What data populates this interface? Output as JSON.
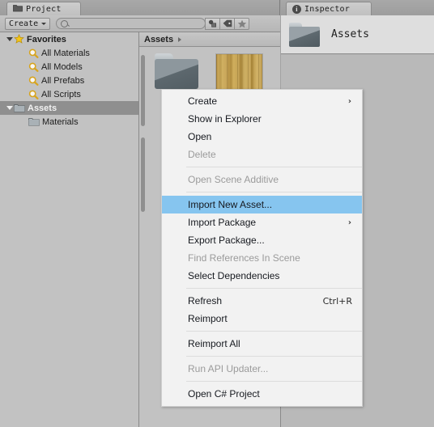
{
  "project_panel": {
    "tab_label": "Project",
    "tab_icon": "folder-icon",
    "toolbar": {
      "create_label": "Create",
      "search_value": "",
      "search_placeholder": "",
      "filter_buttons": [
        {
          "name": "filter-by-type-icon",
          "glyph": "◤"
        },
        {
          "name": "filter-by-label-icon",
          "glyph": "◆"
        },
        {
          "name": "filter-by-favorite-icon",
          "glyph": "★"
        }
      ]
    },
    "tree": [
      {
        "label": "Favorites",
        "icon": "star-icon",
        "indent": 0,
        "expanded": true,
        "bold": true,
        "selected": false
      },
      {
        "label": "All Materials",
        "icon": "search-icon",
        "indent": 1,
        "expanded": null,
        "bold": false,
        "selected": false
      },
      {
        "label": "All Models",
        "icon": "search-icon",
        "indent": 1,
        "expanded": null,
        "bold": false,
        "selected": false
      },
      {
        "label": "All Prefabs",
        "icon": "search-icon",
        "indent": 1,
        "expanded": null,
        "bold": false,
        "selected": false
      },
      {
        "label": "All Scripts",
        "icon": "search-icon",
        "indent": 1,
        "expanded": null,
        "bold": false,
        "selected": false
      },
      {
        "label": "Assets",
        "icon": "folder-icon",
        "indent": 0,
        "expanded": true,
        "bold": true,
        "selected": true
      },
      {
        "label": "Materials",
        "icon": "folder-icon",
        "indent": 1,
        "expanded": null,
        "bold": false,
        "selected": false
      }
    ],
    "breadcrumb": "Assets",
    "assets": [
      {
        "name": "folder-asset",
        "kind": "folder",
        "label": ""
      },
      {
        "name": "wood-texture-asset",
        "kind": "texture",
        "label": ""
      }
    ]
  },
  "inspector_panel": {
    "tab_label": "Inspector",
    "tab_icon": "info-icon",
    "badge_char": "i",
    "header_title": "Assets",
    "header_icon": "folder-icon"
  },
  "context_menu": {
    "items": [
      {
        "label": "Create",
        "type": "item",
        "disabled": false,
        "highlight": false,
        "submenu": true,
        "shortcut": ""
      },
      {
        "label": "Show in Explorer",
        "type": "item",
        "disabled": false,
        "highlight": false,
        "submenu": false,
        "shortcut": ""
      },
      {
        "label": "Open",
        "type": "item",
        "disabled": false,
        "highlight": false,
        "submenu": false,
        "shortcut": ""
      },
      {
        "label": "Delete",
        "type": "item",
        "disabled": true,
        "highlight": false,
        "submenu": false,
        "shortcut": ""
      },
      {
        "type": "separator"
      },
      {
        "label": "Open Scene Additive",
        "type": "item",
        "disabled": true,
        "highlight": false,
        "submenu": false,
        "shortcut": ""
      },
      {
        "type": "separator"
      },
      {
        "label": "Import New Asset...",
        "type": "item",
        "disabled": false,
        "highlight": true,
        "submenu": false,
        "shortcut": ""
      },
      {
        "label": "Import Package",
        "type": "item",
        "disabled": false,
        "highlight": false,
        "submenu": true,
        "shortcut": ""
      },
      {
        "label": "Export Package...",
        "type": "item",
        "disabled": false,
        "highlight": false,
        "submenu": false,
        "shortcut": ""
      },
      {
        "label": "Find References In Scene",
        "type": "item",
        "disabled": true,
        "highlight": false,
        "submenu": false,
        "shortcut": ""
      },
      {
        "label": "Select Dependencies",
        "type": "item",
        "disabled": false,
        "highlight": false,
        "submenu": false,
        "shortcut": ""
      },
      {
        "type": "separator"
      },
      {
        "label": "Refresh",
        "type": "item",
        "disabled": false,
        "highlight": false,
        "submenu": false,
        "shortcut": "Ctrl+R"
      },
      {
        "label": "Reimport",
        "type": "item",
        "disabled": false,
        "highlight": false,
        "submenu": false,
        "shortcut": ""
      },
      {
        "type": "separator"
      },
      {
        "label": "Reimport All",
        "type": "item",
        "disabled": false,
        "highlight": false,
        "submenu": false,
        "shortcut": ""
      },
      {
        "type": "separator"
      },
      {
        "label": "Run API Updater...",
        "type": "item",
        "disabled": true,
        "highlight": false,
        "submenu": false,
        "shortcut": ""
      },
      {
        "type": "separator"
      },
      {
        "label": "Open C# Project",
        "type": "item",
        "disabled": false,
        "highlight": false,
        "submenu": false,
        "shortcut": ""
      }
    ],
    "submenu_arrow_glyph": "›"
  },
  "colors": {
    "panel_bg": "#c2c2c2",
    "menu_bg": "#f2f2f2",
    "menu_highlight": "#86c5ef",
    "tree_selected": "#8f8f8f",
    "star_yellow": "#f2c218",
    "folder_blue_gray": "#5d686e",
    "wood_tan": "#c9a44e"
  }
}
